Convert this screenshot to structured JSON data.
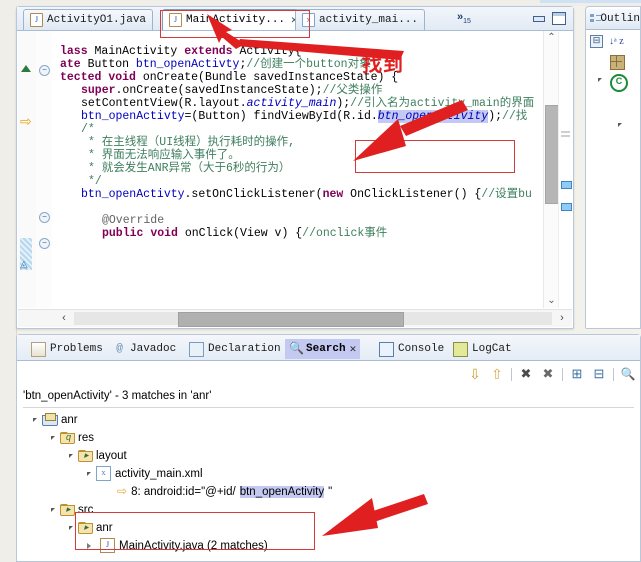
{
  "editor": {
    "tabs": [
      {
        "label": "ActivityO1.java",
        "icon": "java-file-icon",
        "active": false,
        "closable": false
      },
      {
        "label": "MainActivity...",
        "icon": "java-file-icon",
        "active": true,
        "closable": true
      },
      {
        "label": "activity_mai...",
        "icon": "xml-file-icon",
        "active": false,
        "closable": false
      }
    ],
    "overflow_indicator": "»",
    "overflow_count": "15",
    "window_buttons": [
      "minimize-button",
      "maximize-button"
    ],
    "code_lines": [
      {
        "indent": 0,
        "segments": [
          {
            "t": "lass ",
            "c": "kw"
          },
          {
            "t": "MainActivity ",
            "c": ""
          },
          {
            "t": "extends ",
            "c": "kw"
          },
          {
            "t": "Activity{",
            "c": ""
          }
        ]
      },
      {
        "indent": 0,
        "segments": [
          {
            "t": "ate ",
            "c": "kw"
          },
          {
            "t": "Button ",
            "c": ""
          },
          {
            "t": "btn_openActivty",
            "c": "fld"
          },
          {
            "t": ";",
            "c": ""
          },
          {
            "t": "//创建一个button对象",
            "c": "cmt"
          }
        ]
      },
      {
        "indent": 0,
        "segments": [
          {
            "t": "tected ",
            "c": "kw"
          },
          {
            "t": "void ",
            "c": "kw"
          },
          {
            "t": "onCreate(",
            "c": ""
          },
          {
            "t": "Bundle savedInstanceState) {",
            "c": ""
          }
        ]
      },
      {
        "indent": 3,
        "segments": [
          {
            "t": "super",
            "c": "kw"
          },
          {
            "t": ".onCreate(savedInstanceState);",
            "c": ""
          },
          {
            "t": "//父类操作",
            "c": "cmt"
          }
        ]
      },
      {
        "indent": 3,
        "segments": [
          {
            "t": "setContentView(R.layout.",
            "c": ""
          },
          {
            "t": "activity_main",
            "c": "fldi"
          },
          {
            "t": ");",
            "c": ""
          },
          {
            "t": "//引入名为activity_main的界面",
            "c": "cmt"
          }
        ]
      },
      {
        "indent": 3,
        "segments": [
          {
            "t": "btn_openActivty",
            "c": "fld"
          },
          {
            "t": "=(Button) findViewById(R.id.",
            "c": ""
          },
          {
            "t": "btn_openActivity",
            "c": "fldi-sel"
          },
          {
            "t": ");",
            "c": ""
          },
          {
            "t": "//找",
            "c": "cmt"
          }
        ]
      },
      {
        "indent": 3,
        "segments": [
          {
            "t": "/*",
            "c": "cmt"
          }
        ]
      },
      {
        "indent": 4,
        "segments": [
          {
            "t": "* 在主线程（UI线程）执行耗时的操作,",
            "c": "cmt"
          }
        ]
      },
      {
        "indent": 4,
        "segments": [
          {
            "t": "* 界面无法响应输入事件了。",
            "c": "cmt"
          }
        ]
      },
      {
        "indent": 4,
        "segments": [
          {
            "t": "* 就会发生ANR异常（大于6秒的行为）",
            "c": "cmt"
          }
        ]
      },
      {
        "indent": 4,
        "segments": [
          {
            "t": "*/",
            "c": "cmt"
          }
        ]
      },
      {
        "indent": 3,
        "segments": [
          {
            "t": "btn_openActivty",
            "c": "fld"
          },
          {
            "t": ".setOnClickListener(",
            "c": ""
          },
          {
            "t": "new ",
            "c": "kw"
          },
          {
            "t": "OnClickListener() {",
            "c": ""
          },
          {
            "t": "//设置bu",
            "c": "cmt"
          }
        ]
      },
      {
        "indent": 6,
        "segments": [
          {
            "t": "@Override",
            "c": "ann"
          }
        ]
      },
      {
        "indent": 6,
        "segments": [
          {
            "t": "public ",
            "c": "kw"
          },
          {
            "t": "void ",
            "c": "kw"
          },
          {
            "t": "onClick(",
            "c": ""
          },
          {
            "t": "View v) {",
            "c": ""
          },
          {
            "t": "//onclick事件",
            "c": "cmt"
          }
        ]
      }
    ]
  },
  "outline": {
    "title": "Outlin",
    "collapse_all_label": "⊟",
    "sort_label": "↓ᵃ z"
  },
  "bottom_panel": {
    "tabs": [
      {
        "label": "Problems",
        "icon": "problems-icon",
        "selected": false
      },
      {
        "label": "Javadoc",
        "icon": "javadoc-icon",
        "selected": false
      },
      {
        "label": "Declaration",
        "icon": "declaration-icon",
        "selected": false
      },
      {
        "label": "Search",
        "icon": "search-icon",
        "selected": true
      },
      {
        "label": "Console",
        "icon": "console-icon",
        "selected": false
      },
      {
        "label": "LogCat",
        "icon": "logcat-icon",
        "selected": false
      }
    ],
    "search_tab_close": "✕",
    "toolbar": [
      {
        "name": "next-match-button",
        "glyph": "⇩"
      },
      {
        "name": "previous-match-button",
        "glyph": "⇧"
      },
      {
        "name": "remove-selected-matches-button",
        "glyph": "✖"
      },
      {
        "name": "remove-all-matches-button",
        "glyph": "✖"
      },
      {
        "name": "expand-all-button",
        "glyph": "⊞"
      },
      {
        "name": "collapse-all-button",
        "glyph": "⊟"
      },
      {
        "name": "search-history-button",
        "glyph": "🔍"
      }
    ],
    "result_header": "'btn_openActivity' - 3 matches in 'anr'",
    "tree": [
      {
        "depth": 0,
        "label": "anr",
        "icon": "project-icon",
        "twisty": "open"
      },
      {
        "depth": 1,
        "label": "res",
        "icon": "source-folder-icon",
        "twisty": "open"
      },
      {
        "depth": 2,
        "label": "layout",
        "icon": "folder-icon",
        "twisty": "open"
      },
      {
        "depth": 3,
        "label": "activity_main.xml",
        "icon": "xml-file-icon",
        "twisty": "open"
      },
      {
        "depth": 4,
        "label": "8: android:id=\"@+id/",
        "highlight": "btn_openActivity",
        "suffix": "\"",
        "icon": "match-arrow-icon",
        "twisty": "none"
      },
      {
        "depth": 1,
        "label": "src",
        "icon": "folder-icon",
        "twisty": "open"
      },
      {
        "depth": 2,
        "label": "anr",
        "icon": "folder-icon",
        "twisty": "open"
      },
      {
        "depth": 3,
        "label": "MainActivity.java (2 matches)",
        "icon": "java-file-icon",
        "twisty": "closed"
      }
    ]
  },
  "annotations": {
    "found_text": "找到",
    "accent_color": "#e02020",
    "box_color": "#d33a3a"
  }
}
